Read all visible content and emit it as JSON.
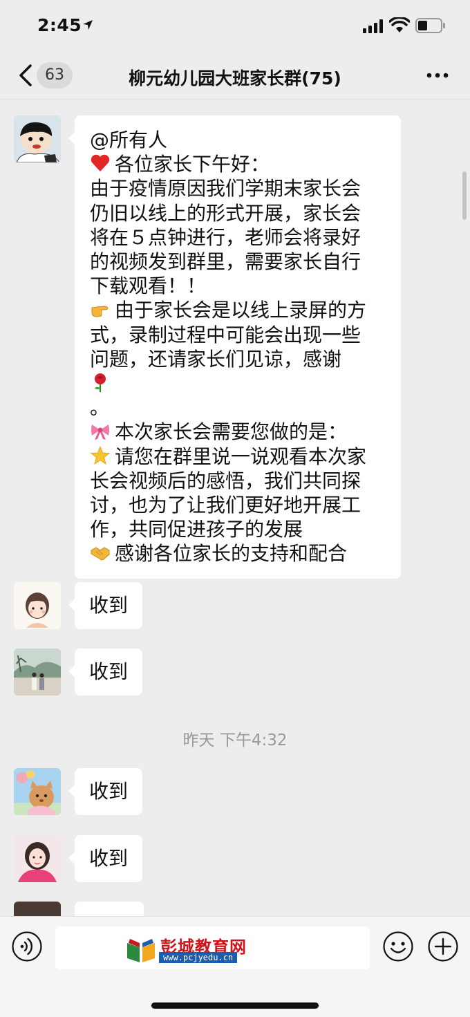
{
  "status_bar": {
    "time": "2:45",
    "icons": [
      "location-arrow-icon",
      "signal-icon",
      "wifi-icon",
      "battery-icon"
    ]
  },
  "nav": {
    "unread_count": "63",
    "title": "柳元幼儿园大班家长群(75)",
    "icons": [
      "back-chevron-icon",
      "more-dots-icon"
    ]
  },
  "messages": [
    {
      "avatar": "avatar-cartoon-boy",
      "lines": [
        {
          "emoji": "",
          "text": "@所有人"
        },
        {
          "emoji": "heart",
          "text": "各位家长下午好："
        },
        {
          "emoji": "",
          "text": "由于疫情原因我们学期末家长会"
        },
        {
          "emoji": "",
          "text": "仍旧以线上的形式开展，家长会"
        },
        {
          "emoji": "",
          "text": "将在５点钟进行，老师会将录好"
        },
        {
          "emoji": "",
          "text": "的视频发到群里，需要家长自行"
        },
        {
          "emoji": "",
          "text": "下载观看！！"
        },
        {
          "emoji": "pointing-hand",
          "text": "由于家长会是以线上录屏的方"
        },
        {
          "emoji": "",
          "text": "式，录制过程中可能会出现一些"
        },
        {
          "emoji": "",
          "text": "问题，还请家长们见谅，感谢"
        },
        {
          "emoji": "rose",
          "text": ""
        },
        {
          "emoji": "",
          "text": "。"
        },
        {
          "emoji": "ribbon",
          "text": "本次家长会需要您做的是："
        },
        {
          "emoji": "star",
          "text": "请您在群里说一说观看本次家"
        },
        {
          "emoji": "",
          "text": "长会视频后的感悟，我们共同探"
        },
        {
          "emoji": "",
          "text": "讨，也为了让我们更好地开展工"
        },
        {
          "emoji": "",
          "text": "作，共同促进孩子的发展"
        },
        {
          "emoji": "handshake",
          "text": "感谢各位家长的支持和配合"
        }
      ]
    },
    {
      "avatar": "avatar-girl-drawing",
      "text": "收到"
    },
    {
      "avatar": "avatar-couple-photo",
      "text": "收到"
    },
    {
      "avatar": "avatar-cartoon-cat",
      "text": "收到"
    },
    {
      "avatar": "avatar-woman-photo",
      "text": "收到"
    }
  ],
  "timestamp": "昨天 下午4:32",
  "input_bar": {
    "icons": [
      "voice-icon",
      "emoji-face-icon",
      "plus-circle-icon"
    ],
    "watermark": {
      "title": "彭城教育网",
      "url": "www.pcjyedu.cn"
    }
  },
  "colors": {
    "background": "#ededed",
    "bubble": "#ffffff",
    "timestamp": "#999999",
    "watermark_red": "#d0131b",
    "watermark_blue": "#1d5db0"
  }
}
